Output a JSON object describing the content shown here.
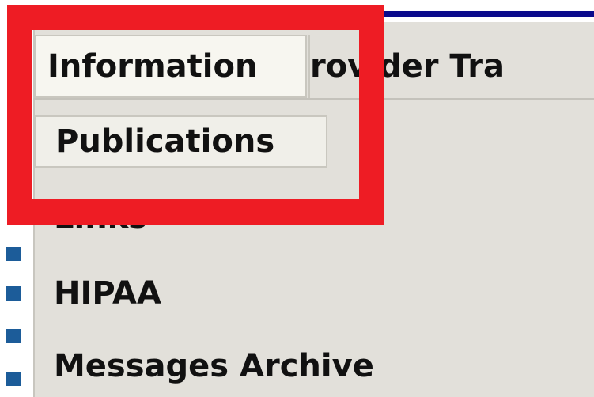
{
  "menubar": {
    "items": [
      {
        "label": "Information"
      },
      {
        "label": "rovider  Tra"
      }
    ]
  },
  "submenu": {
    "items": [
      {
        "label": "Publications"
      },
      {
        "label": "Links"
      },
      {
        "label": "HIPAA"
      },
      {
        "label": "Messages Archive"
      }
    ]
  },
  "colors": {
    "highlight": "#ee1c24",
    "menu_background": "#e2e0da",
    "top_bar": "#0a0a8c",
    "bullet": "#1c5c99"
  },
  "icons": [
    "bullet-square-icon"
  ]
}
